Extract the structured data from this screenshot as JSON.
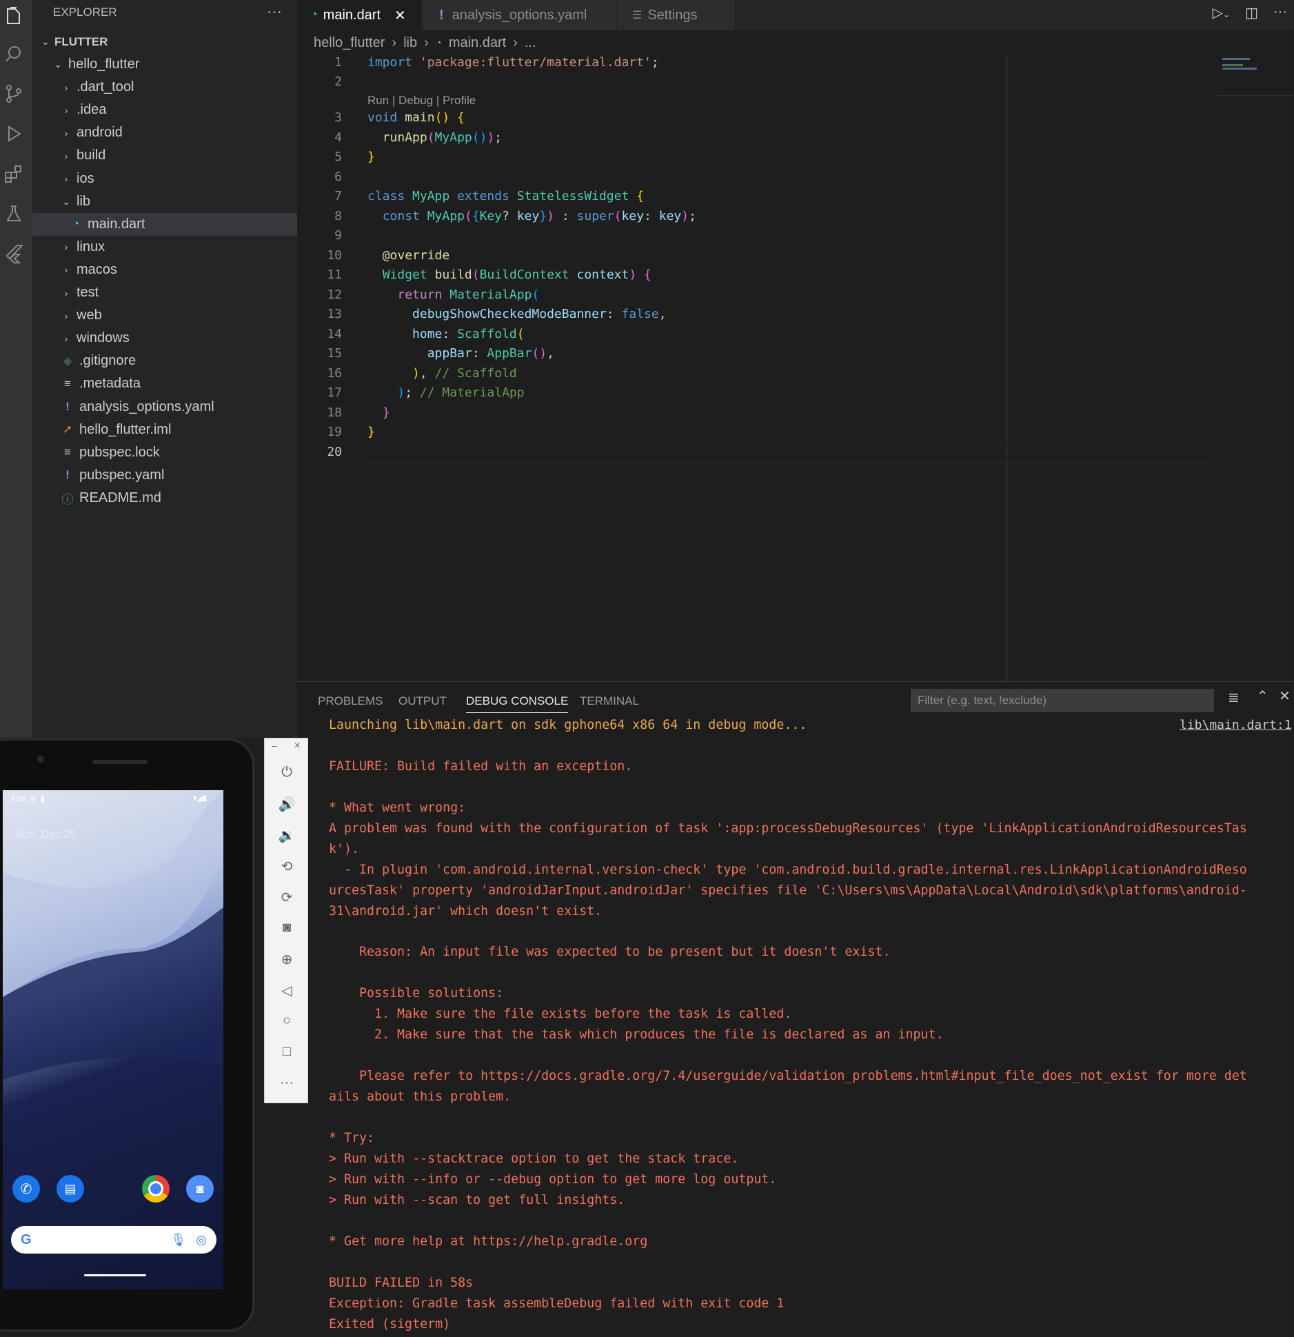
{
  "activity_bar": {
    "icons": [
      "files-icon",
      "search-icon",
      "source-control-icon",
      "run-debug-icon",
      "extensions-icon",
      "testing-icon",
      "flutter-icon"
    ]
  },
  "explorer": {
    "title": "EXPLORER",
    "more": "···",
    "root": "FLUTTER",
    "items": [
      {
        "label": "hello_flutter",
        "kind": "folder-open",
        "depth": 1
      },
      {
        "label": ".dart_tool",
        "kind": "folder",
        "depth": 2
      },
      {
        "label": ".idea",
        "kind": "folder",
        "depth": 2
      },
      {
        "label": "android",
        "kind": "folder",
        "depth": 2
      },
      {
        "label": "build",
        "kind": "folder",
        "depth": 2
      },
      {
        "label": "ios",
        "kind": "folder",
        "depth": 2
      },
      {
        "label": "lib",
        "kind": "folder-open",
        "depth": 2
      },
      {
        "label": "main.dart",
        "kind": "dart",
        "depth": 3,
        "selected": true
      },
      {
        "label": "linux",
        "kind": "folder",
        "depth": 2
      },
      {
        "label": "macos",
        "kind": "folder",
        "depth": 2
      },
      {
        "label": "test",
        "kind": "folder",
        "depth": 2
      },
      {
        "label": "web",
        "kind": "folder",
        "depth": 2
      },
      {
        "label": "windows",
        "kind": "folder",
        "depth": 2
      },
      {
        "label": ".gitignore",
        "kind": "git",
        "depth": 2
      },
      {
        "label": ".metadata",
        "kind": "lines",
        "depth": 2
      },
      {
        "label": "analysis_options.yaml",
        "kind": "yaml",
        "depth": 2
      },
      {
        "label": "hello_flutter.iml",
        "kind": "rss",
        "depth": 2
      },
      {
        "label": "pubspec.lock",
        "kind": "lines",
        "depth": 2
      },
      {
        "label": "pubspec.yaml",
        "kind": "yaml",
        "depth": 2
      },
      {
        "label": "README.md",
        "kind": "info",
        "depth": 2
      }
    ]
  },
  "tabs": [
    {
      "label": "main.dart",
      "icon": "dart-icon",
      "active": true,
      "close": "✕"
    },
    {
      "label": "analysis_options.yaml",
      "icon": "yaml-icon",
      "active": false
    },
    {
      "label": "Settings",
      "icon": "settings-icon",
      "active": false
    }
  ],
  "breadcrumb": [
    "hello_flutter",
    "lib",
    "main.dart",
    "..."
  ],
  "editor": {
    "codelens": "Run | Debug | Profile",
    "line_numbers": [
      "1",
      "2",
      "3",
      "4",
      "5",
      "6",
      "7",
      "8",
      "9",
      "10",
      "11",
      "12",
      "13",
      "14",
      "15",
      "16",
      "17",
      "18",
      "19",
      "20"
    ]
  },
  "panel": {
    "tabs": [
      "PROBLEMS",
      "OUTPUT",
      "DEBUG CONSOLE",
      "TERMINAL"
    ],
    "active_tab": "DEBUG CONSOLE",
    "filter_placeholder": "Filter (e.g. text, !exclude)",
    "source_link": "lib\\main.dart:1",
    "lines": [
      {
        "text": "Launching lib\\main.dart on sdk gphone64 x86 64 in debug mode...",
        "color": "orange"
      },
      {
        "text": "",
        "color": "red"
      },
      {
        "text": "FAILURE: Build failed with an exception.",
        "color": "red"
      },
      {
        "text": "",
        "color": "red"
      },
      {
        "text": "* What went wrong:",
        "color": "red"
      },
      {
        "text": "A problem was found with the configuration of task ':app:processDebugResources' (type 'LinkApplicationAndroidResourcesTas",
        "color": "red"
      },
      {
        "text": "k').",
        "color": "red"
      },
      {
        "text": "  - In plugin 'com.android.internal.version-check' type 'com.android.build.gradle.internal.res.LinkApplicationAndroidReso",
        "color": "red"
      },
      {
        "text": "urcesTask' property 'androidJarInput.androidJar' specifies file 'C:\\Users\\ms\\AppData\\Local\\Android\\sdk\\platforms\\android-",
        "color": "red"
      },
      {
        "text": "31\\android.jar' which doesn't exist.",
        "color": "red"
      },
      {
        "text": "",
        "color": "red"
      },
      {
        "text": "    Reason: An input file was expected to be present but it doesn't exist.",
        "color": "red"
      },
      {
        "text": "",
        "color": "red"
      },
      {
        "text": "    Possible solutions:",
        "color": "red"
      },
      {
        "text": "      1. Make sure the file exists before the task is called.",
        "color": "red"
      },
      {
        "text": "      2. Make sure that the task which produces the file is declared as an input.",
        "color": "red"
      },
      {
        "text": "",
        "color": "red"
      },
      {
        "text": "    Please refer to https://docs.gradle.org/7.4/userguide/validation_problems.html#input_file_does_not_exist for more det",
        "color": "red"
      },
      {
        "text": "ails about this problem.",
        "color": "red"
      },
      {
        "text": "",
        "color": "red"
      },
      {
        "text": "* Try:",
        "color": "red"
      },
      {
        "text": "> Run with --stacktrace option to get the stack trace.",
        "color": "red"
      },
      {
        "text": "> Run with --info or --debug option to get more log output.",
        "color": "red"
      },
      {
        "text": "> Run with --scan to get full insights.",
        "color": "red"
      },
      {
        "text": "",
        "color": "red"
      },
      {
        "text": "* Get more help at https://help.gradle.org",
        "color": "red"
      },
      {
        "text": "",
        "color": "red"
      },
      {
        "text": "BUILD FAILED in 58s",
        "color": "red"
      },
      {
        "text": "Exception: Gradle task assembleDebug failed with exit code 1",
        "color": "red"
      },
      {
        "text": "Exited (sigterm)",
        "color": "red"
      }
    ]
  },
  "emulator": {
    "status_time": "4:58",
    "date_text": "Sun, Dec 25",
    "toolbar": [
      "power-icon",
      "volume-up-icon",
      "volume-down-icon",
      "rotate-left-icon",
      "rotate-right-icon",
      "camera-icon",
      "zoom-icon",
      "back-icon",
      "home-icon",
      "overview-icon",
      "more-icon"
    ],
    "minimize": "–",
    "close": "×",
    "dock": [
      "phone-app-icon",
      "messages-app-icon",
      "chrome-app-icon",
      "camera-app-icon"
    ]
  },
  "colors": {
    "accent": "#007acc",
    "error": "#f1725b",
    "warning": "#e9a84d"
  }
}
